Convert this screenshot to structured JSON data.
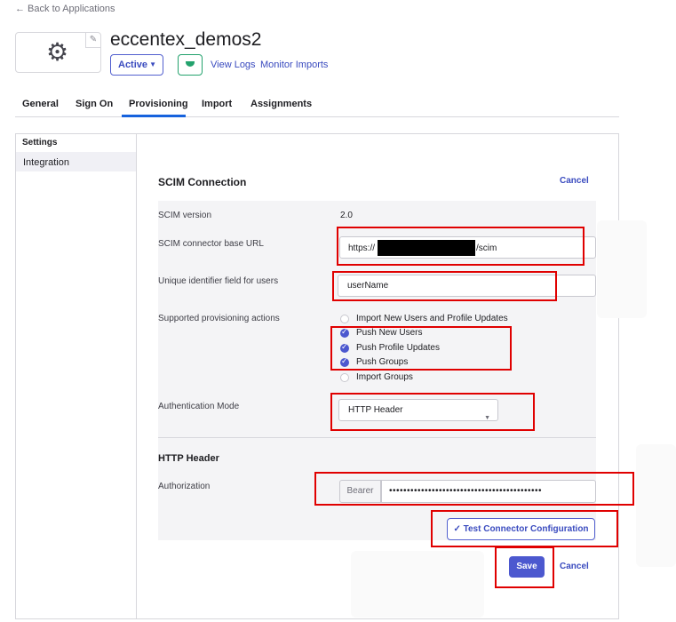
{
  "header": {
    "back_link": "← Back to Applications",
    "app_title": "eccentex_demos2",
    "status": "Active",
    "view_logs": "View Logs",
    "monitor_imports": "Monitor Imports"
  },
  "tabs": [
    {
      "label": "General"
    },
    {
      "label": "Sign On"
    },
    {
      "label": "Provisioning",
      "active": true
    },
    {
      "label": "Import"
    },
    {
      "label": "Assignments"
    }
  ],
  "sidebar": {
    "heading": "Settings",
    "items": [
      {
        "label": "Integration",
        "selected": true
      }
    ]
  },
  "scim": {
    "title": "SCIM Connection",
    "cancel": "Cancel",
    "version_label": "SCIM version",
    "version_value": "2.0",
    "base_url_label": "SCIM connector base URL",
    "base_url_prefix": "https://",
    "base_url_suffix": "/scim",
    "unique_id_label": "Unique identifier field for users",
    "unique_id_value": "userName",
    "actions_label": "Supported provisioning actions",
    "actions": [
      {
        "label": "Import New Users and Profile Updates",
        "checked": false
      },
      {
        "label": "Push New Users",
        "checked": true
      },
      {
        "label": "Push Profile Updates",
        "checked": true
      },
      {
        "label": "Push Groups",
        "checked": true
      },
      {
        "label": "Import Groups",
        "checked": false
      }
    ],
    "auth_mode_label": "Authentication Mode",
    "auth_mode_value": "HTTP Header"
  },
  "http_header": {
    "title": "HTTP Header",
    "authorization_label": "Authorization",
    "bearer": "Bearer",
    "token_mask": "•••••••••••••••••••••••••••••••••••••••••••",
    "test_button": "Test Connector Configuration"
  },
  "footer": {
    "save": "Save",
    "cancel": "Cancel"
  },
  "colors": {
    "accent": "#4c58cf",
    "link": "#3a4bbf",
    "highlight": "#e00000",
    "success": "#23a26d"
  }
}
